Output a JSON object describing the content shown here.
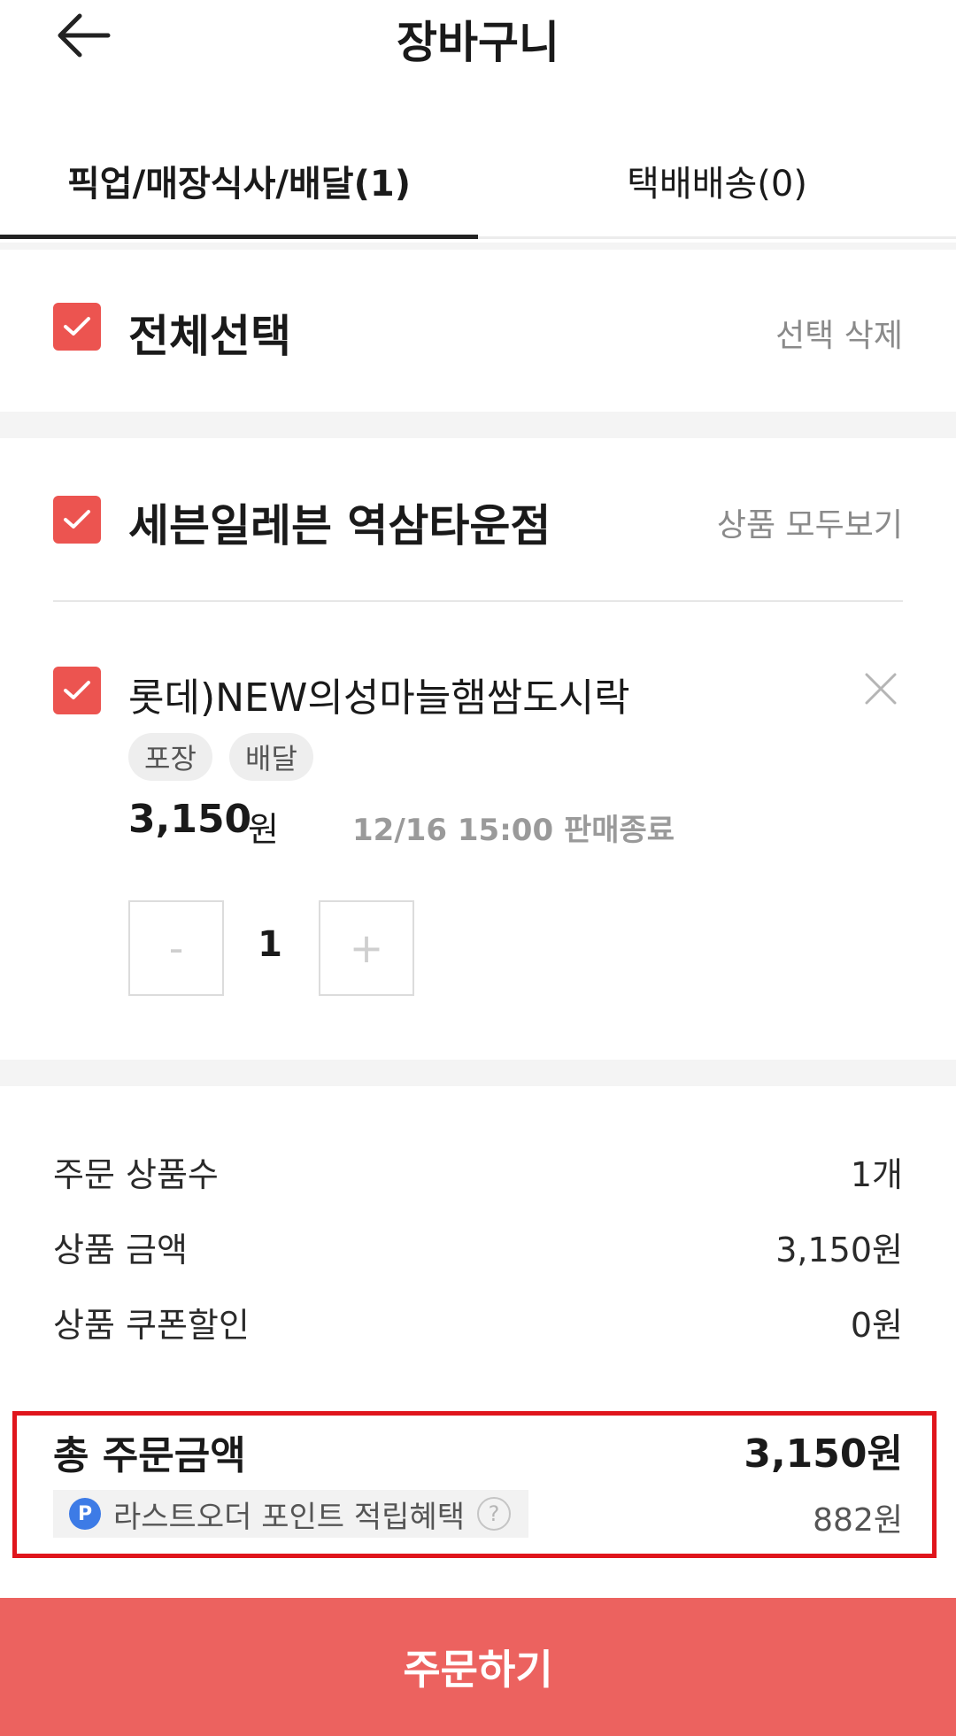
{
  "header": {
    "title": "장바구니"
  },
  "tabs": [
    {
      "label": "픽업/매장식사/배달(1)",
      "active": true
    },
    {
      "label": "택배배송(0)",
      "active": false
    }
  ],
  "select_all": {
    "label": "전체선택",
    "delete_label": "선택 삭제",
    "checked": true
  },
  "store": {
    "name": "세븐일레븐 역삼타운점",
    "view_all_label": "상품 모두보기",
    "checked": true
  },
  "product": {
    "name": "롯데)NEW의성마늘햄쌈도시락",
    "checked": true,
    "tags": [
      "포장",
      "배달"
    ],
    "price": "3,150",
    "price_unit": "원",
    "deadline": "12/16 15:00 판매종료",
    "quantity": "1",
    "minus_label": "-",
    "plus_label": "+"
  },
  "summary": {
    "rows": [
      {
        "label": "주문 상품수",
        "value": "1개"
      },
      {
        "label": "상품 금액",
        "value": "3,150원"
      },
      {
        "label": "상품 쿠폰할인",
        "value": "0원"
      }
    ],
    "total_label": "총 주문금액",
    "total_value": "3,150원",
    "points_badge": "P",
    "points_label": "라스트오더 포인트 적립혜택",
    "points_help": "?",
    "points_value": "882원"
  },
  "order_button": {
    "label": "주문하기"
  },
  "colors": {
    "accent": "#ec5450",
    "order_button": "#ec625f",
    "highlight_border": "#e0151c",
    "points_badge": "#3d7be6"
  }
}
